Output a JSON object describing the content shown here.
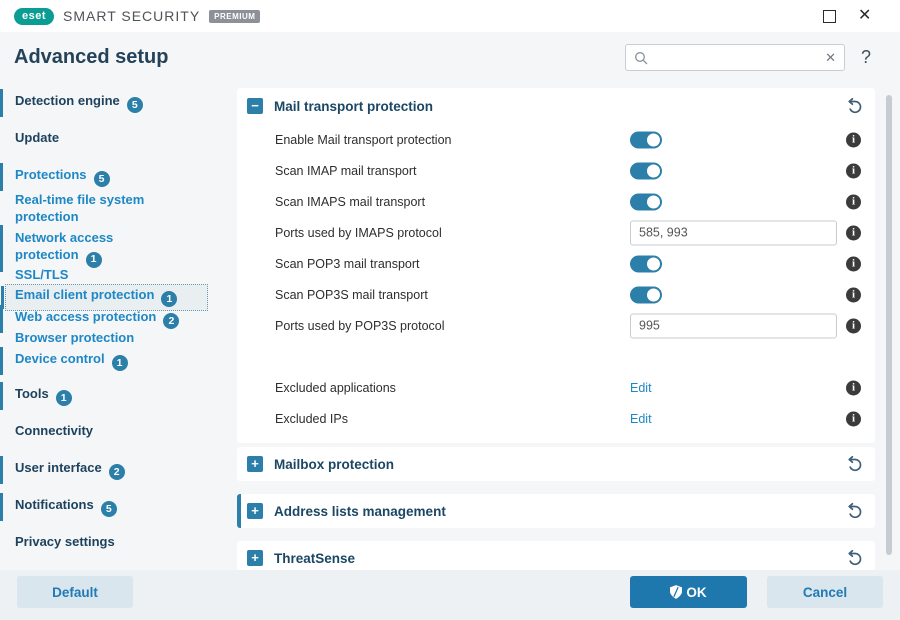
{
  "titlebar": {
    "logo": "eset",
    "product": "SMART SECURITY",
    "edition": "PREMIUM"
  },
  "header": {
    "title": "Advanced setup",
    "search_placeholder": "",
    "help": "?"
  },
  "sidebar": {
    "items": [
      {
        "label": "Detection engine",
        "badge": "5"
      },
      {
        "label": "Update"
      },
      {
        "label": "Protections",
        "badge": "5"
      },
      {
        "label": "Real-time file system protection"
      },
      {
        "label": "Network access protection",
        "badge": "1"
      },
      {
        "label": "SSL/TLS"
      },
      {
        "label": "Email client protection",
        "badge": "1",
        "selected": true
      },
      {
        "label": "Web access protection",
        "badge": "2"
      },
      {
        "label": "Browser protection"
      },
      {
        "label": "Device control",
        "badge": "1"
      },
      {
        "label": "Tools",
        "badge": "1"
      },
      {
        "label": "Connectivity"
      },
      {
        "label": "User interface",
        "badge": "2"
      },
      {
        "label": "Notifications",
        "badge": "5"
      },
      {
        "label": "Privacy settings"
      }
    ]
  },
  "main": {
    "mail_card": {
      "title": "Mail transport protection",
      "rows": [
        {
          "label": "Enable Mail transport protection",
          "type": "toggle",
          "state": "on"
        },
        {
          "label": "Scan IMAP mail transport",
          "type": "toggle",
          "state": "on"
        },
        {
          "label": "Scan IMAPS mail transport",
          "type": "toggle",
          "state": "on"
        },
        {
          "label": "Ports used by IMAPS protocol",
          "type": "input",
          "value": "585, 993"
        },
        {
          "label": "Scan POP3 mail transport",
          "type": "toggle",
          "state": "on"
        },
        {
          "label": "Scan POP3S mail transport",
          "type": "toggle",
          "state": "on"
        },
        {
          "label": "Ports used by POP3S protocol",
          "type": "input",
          "value": "995"
        },
        {
          "label": "Excluded applications",
          "type": "link",
          "value": "Edit"
        },
        {
          "label": "Excluded IPs",
          "type": "link",
          "value": "Edit"
        }
      ]
    },
    "collapsed_sections": [
      {
        "title": "Mailbox protection"
      },
      {
        "title": "Address lists management"
      },
      {
        "title": "ThreatSense"
      }
    ]
  },
  "footer": {
    "default_label": "Default",
    "ok_label": "OK",
    "cancel_label": "Cancel"
  },
  "colors": {
    "accent": "#2b7fa8",
    "link": "#1e87c5",
    "navy": "#1b4664",
    "ok_button": "#1f78ad",
    "panel_bg": "#f4f6f7",
    "footer_bg": "#edf1f4",
    "logo_teal": "#0a9d93"
  }
}
